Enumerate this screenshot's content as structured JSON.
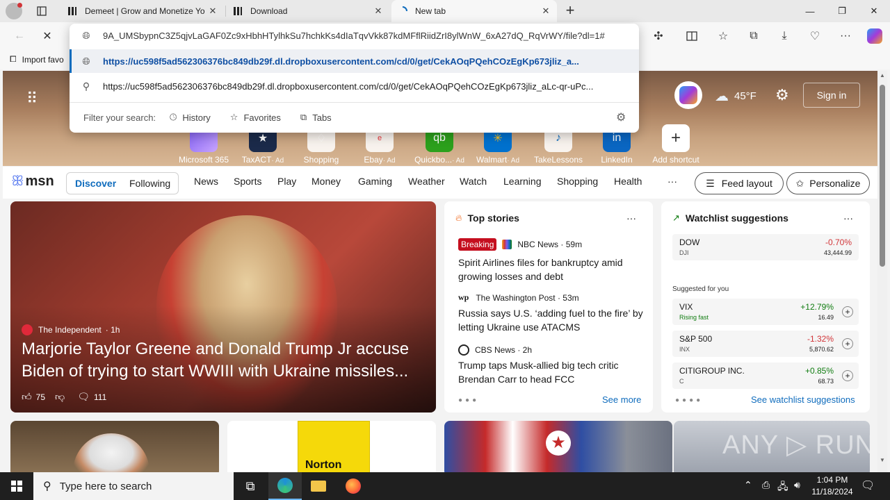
{
  "tabs": [
    {
      "title": "Demeet | Grow and Monetize Yo",
      "close": "✕"
    },
    {
      "title": "Download",
      "close": "✕"
    },
    {
      "title": "New tab",
      "close": "✕"
    }
  ],
  "new_tab": "+",
  "window": {
    "minimize": "—",
    "maximize": "❐",
    "close": "✕"
  },
  "omnibox": {
    "input_value": "9A_UMSbypnC3Z5qjvLaGAF0Zc9xHbhHTylhkSu7hchkKs4dIaTqvVkk87kdMFflRiidZrI8ylWnW_6xA27dQ_RqVrWY/file?dl=1#",
    "suggestion_1": "https://uc598f5ad562306376bc849db29f.dl.dropboxusercontent.com/cd/0/get/CekAOqPQehCOzEgKp673jliz_a...",
    "suggestion_2": "https://uc598f5ad562306376bc849db29f.dl.dropboxusercontent.com/cd/0/get/CekAOqPQehCOzEgKp673jliz_aLc-qr-uPc...",
    "filter_label": "Filter your search:",
    "filter_history": "History",
    "filter_favorites": "Favorites",
    "filter_tabs": "Tabs"
  },
  "favbar": {
    "import": "Import favo"
  },
  "hero": {
    "weather_temp": "45°F",
    "signin": "Sign in",
    "shortcuts": [
      {
        "label": "Microsoft 365",
        "ad": ""
      },
      {
        "label": "TaxACT",
        "ad": "· Ad"
      },
      {
        "label": "Shopping",
        "ad": ""
      },
      {
        "label": "Ebay",
        "ad": "· Ad"
      },
      {
        "label": "Quickbo...",
        "ad": "· Ad"
      },
      {
        "label": "Walmart",
        "ad": "· Ad"
      },
      {
        "label": "TakeLessons",
        "ad": ""
      },
      {
        "label": "LinkedIn",
        "ad": ""
      },
      {
        "label": "Add shortcut",
        "ad": ""
      }
    ]
  },
  "nav": {
    "logo": "msn",
    "discover": "Discover",
    "following": "Following",
    "links": [
      "News",
      "Sports",
      "Play",
      "Money",
      "Gaming",
      "Weather",
      "Watch",
      "Learning",
      "Shopping",
      "Health"
    ],
    "more": "···",
    "feed_layout": "Feed layout",
    "personalize": "Personalize"
  },
  "main_story": {
    "source": "The Independent",
    "age": "· 1h",
    "headline": "Marjorie Taylor Greene and Donald Trump Jr accuse Biden of trying to start WWIII with Ukraine missiles...",
    "likes": "75",
    "comments": "111"
  },
  "top_stories": {
    "title": "Top stories",
    "more": "···",
    "items": [
      {
        "badge": "Breaking",
        "source": "NBC News · 59m",
        "headline": "Spirit Airlines files for bankruptcy amid growing losses and debt"
      },
      {
        "badge": "",
        "source": "The Washington Post · 53m",
        "headline": "Russia says U.S. ‘adding fuel to the fire’ by letting Ukraine use ATACMS"
      },
      {
        "badge": "",
        "source": "CBS News · 2h",
        "headline": "Trump taps Musk-allied big tech critic Brendan Carr to head FCC"
      }
    ],
    "see_more": "See more"
  },
  "watchlist": {
    "title": "Watchlist suggestions",
    "more": "···",
    "dow": {
      "name": "DOW",
      "ticker": "DJI",
      "change": "-0.70%",
      "price": "43,444.99"
    },
    "suggested_label": "Suggested for you",
    "stocks": [
      {
        "name": "VIX",
        "ticker": "Rising fast",
        "change": "+12.79%",
        "price": "16.49"
      },
      {
        "name": "S&P 500",
        "ticker": "INX",
        "change": "-1.32%",
        "price": "5,870.62"
      },
      {
        "name": "CITIGROUP INC.",
        "ticker": "C",
        "change": "+0.85%",
        "price": "68.73"
      }
    ],
    "see_all": "See watchlist suggestions"
  },
  "bottom_cards": {
    "norton_label": "Norton",
    "watermark": "ANY ▷ RUN"
  },
  "taskbar": {
    "search_placeholder": "Type here to search",
    "time": "1:04 PM",
    "date": "11/18/2024"
  },
  "colors": {
    "accent": "#0f6cbd",
    "negative": "#d13438",
    "positive": "#107c10",
    "breaking": "#c50f1f"
  }
}
